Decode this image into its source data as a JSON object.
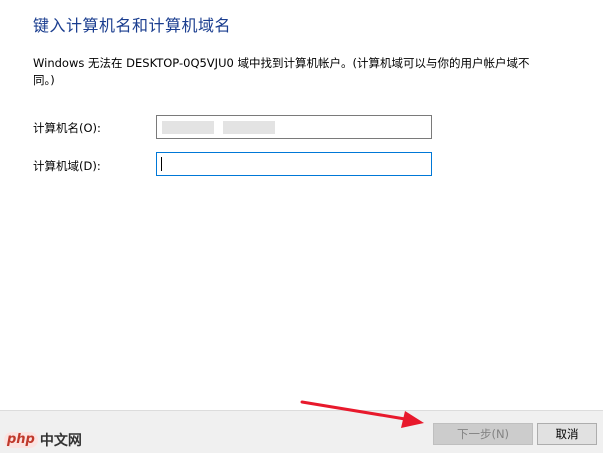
{
  "dialog": {
    "title": "键入计算机名和计算机域名",
    "description": "Windows 无法在 DESKTOP-0Q5VJU0 域中找到计算机帐户。(计算机域可以与你的用户帐户域不同。)"
  },
  "fields": {
    "computer_name": {
      "label": "计算机名(O):",
      "value": ""
    },
    "computer_domain": {
      "label": "计算机域(D):",
      "value": ""
    }
  },
  "buttons": {
    "next": "下一步(N)",
    "cancel": "取消"
  },
  "watermark": {
    "logo": "php",
    "text": "中文网"
  },
  "colors": {
    "title": "#1a3d8f",
    "arrow": "#e8192c",
    "focus_border": "#0078d7"
  }
}
